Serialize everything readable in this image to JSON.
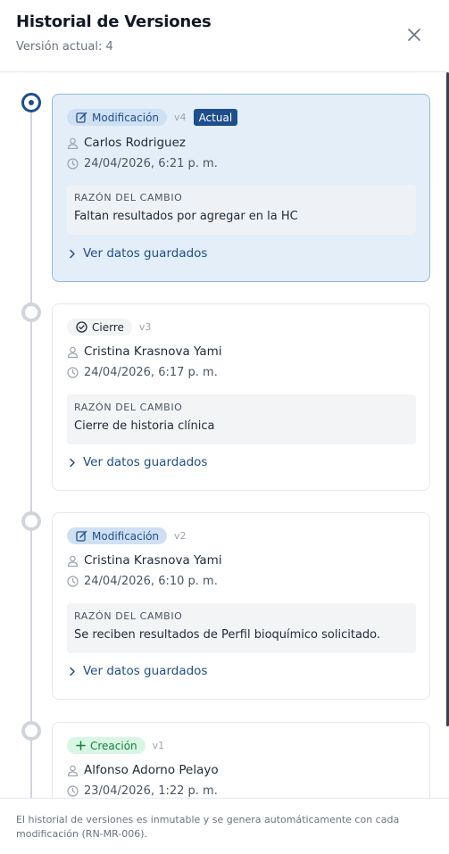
{
  "header": {
    "title": "Historial de Versiones",
    "subtitle": "Versión actual: 4",
    "close_icon": "close-icon"
  },
  "versions": [
    {
      "type": "Modificación",
      "type_icon": "edit-icon",
      "version": "v4",
      "current_label": "Actual",
      "author": "Carlos Rodriguez",
      "date": "24/04/2026, 6:21 p. m.",
      "reason_label": "RAZÓN DEL CAMBIO",
      "reason": "Faltan resultados por agregar en la HC",
      "link": "Ver datos guardados"
    },
    {
      "type": "Cierre",
      "type_icon": "check-circle-icon",
      "version": "v3",
      "author": "Cristina Krasnova Yami",
      "date": "24/04/2026, 6:17 p. m.",
      "reason_label": "RAZÓN DEL CAMBIO",
      "reason": "Cierre de historia clínica",
      "link": "Ver datos guardados"
    },
    {
      "type": "Modificación",
      "type_icon": "edit-icon",
      "version": "v2",
      "author": "Cristina Krasnova Yami",
      "date": "24/04/2026, 6:10 p. m.",
      "reason_label": "RAZÓN DEL CAMBIO",
      "reason": "Se reciben resultados de Perfil bioquímico solicitado.",
      "link": "Ver datos guardados"
    },
    {
      "type": "Creación",
      "type_icon": "plus-icon",
      "version": "v1",
      "author": "Alfonso Adorno Pelayo",
      "date": "23/04/2026, 1:22 p. m."
    }
  ],
  "footer": {
    "text": "El historial de versiones es inmutable y se genera automáticamente con cada modificación (RN-MR-006)."
  },
  "colors": {
    "primary": "#1e4e8c",
    "current_card_bg": "#e3eef9",
    "creation_green": "#15803d"
  }
}
